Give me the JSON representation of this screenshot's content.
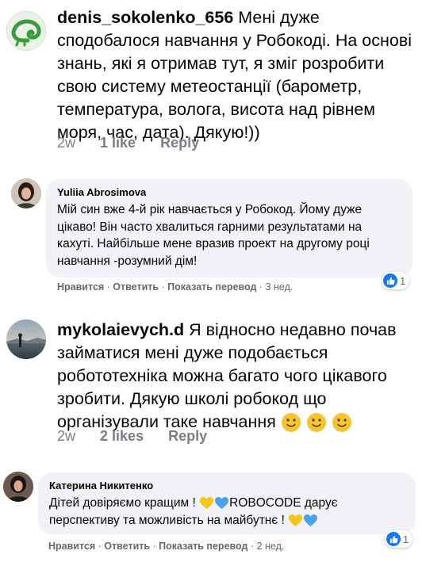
{
  "comments": [
    {
      "author": "denis_sokolenko_656",
      "text": "Мені дуже сподобалося навчання у Робокоді. На основі знань, які я отримав тут, я зміг розробити свою систему метеостанції (барометр, температура, волога, висота над рівнем моря, час, дата). Дякую!))",
      "time": "2w",
      "likes": "1 like",
      "reply": "Reply",
      "avatar_icon": "chameleon-icon",
      "avatar_color": "#3c9b3e"
    },
    {
      "author": "Yuliia Abrosimova",
      "text": "Мій син вже 4-й рік навчається у Робокод. Йому дуже цікаво! Він часто хвалиться гарними результатами на кахуті. Найбільше мене вразив проект на другому році навчання -розумний дім!",
      "like_action": "Нравится",
      "reply_action": "Ответить",
      "translate_action": "Показать перевод",
      "time": "3 нед.",
      "reaction_count": "1"
    },
    {
      "author": "mykolaievych.d",
      "text": "Я відносно недавно почав займатися мені дуже подобається робототехніка можна багато чого цікавого зробити. Дякую школі робокод що організували  таке навчання",
      "emoji_icons": [
        "slightly-smiling-face-icon",
        "slightly-smiling-face-icon",
        "slightly-smiling-face-icon"
      ],
      "time": "2w",
      "likes": "2 likes",
      "reply": "Reply"
    },
    {
      "author": "Катерина Никитенко",
      "text_part1": "Дітей довіряємо кращим !",
      "text_part2": "ROBOCODE дарує перспективу та можливість на майбутнє !",
      "heart_icons": [
        "yellow-heart-icon",
        "blue-heart-icon"
      ],
      "like_action": "Нравится",
      "reply_action": "Ответить",
      "translate_action": "Показать перевод",
      "time": "2 нед.",
      "reaction_count": "1"
    }
  ],
  "separator": " · ",
  "colors": {
    "like_blue": "#1877f2",
    "bubble_bg": "#f0f2f5",
    "meta_gray": "#65676b"
  }
}
